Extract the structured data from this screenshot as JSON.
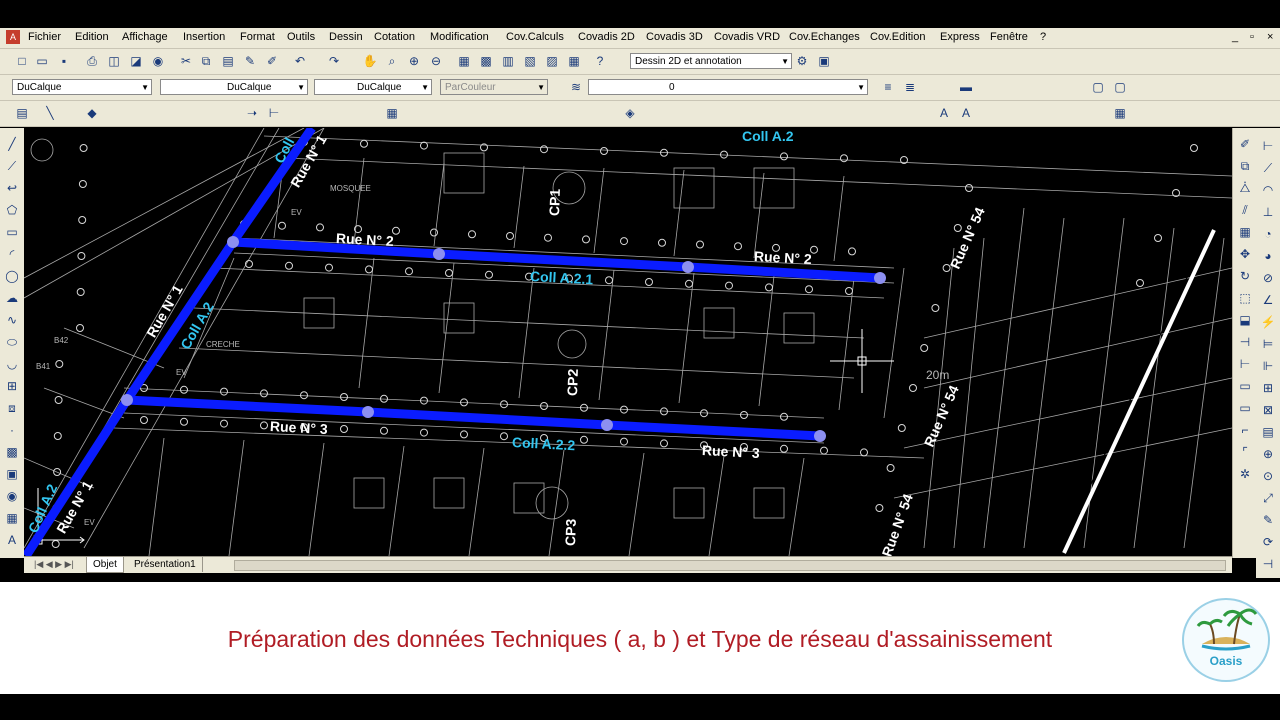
{
  "menu": [
    "Fichier",
    "Edition",
    "Affichage",
    "Insertion",
    "Format",
    "Outils",
    "Dessin",
    "Cotation",
    "Modification",
    "Cov.Calculs",
    "Covadis 2D",
    "Covadis 3D",
    "Covadis VRD",
    "Cov.Echanges",
    "Cov.Edition",
    "Express",
    "Fenêtre",
    "?"
  ],
  "window_controls": [
    "_",
    "▫",
    "×"
  ],
  "toolbar": {
    "workspace": "Dessin 2D et annotation",
    "color": "DuCalque",
    "linetype": "DuCalque",
    "lineweight": "DuCalque",
    "plotstyle": "ParCouleur",
    "layer": "0"
  },
  "icons": {
    "menu_app": "autocad-app-icon",
    "toolbar": [
      "new-icon",
      "open-icon",
      "save-icon",
      "print-icon",
      "preview-icon",
      "publish-icon",
      "plot-icon",
      "cut-icon",
      "copy-icon",
      "paste-icon",
      "matchprop-icon",
      "brush-icon",
      "undo-icon",
      "redo-icon",
      "pan-icon",
      "zoom-icon",
      "zoom-window-icon",
      "zoom-previous-icon",
      "properties-icon",
      "design-center-icon",
      "tool-palette-icon",
      "sheet-set-icon",
      "markup-icon",
      "calculator-icon",
      "help-icon"
    ]
  },
  "drawing": {
    "labels": {
      "coll_a2_top": "Coll A.2",
      "coll_a2_left": "Coll A.2",
      "coll_a2_bottom": "Coll A.2",
      "coll_a21": "Coll A.2.1",
      "coll_a22": "Coll A.2.2",
      "coll_top_left": "Coll",
      "rue1_top": "Rue N° 1",
      "rue1_mid": "Rue N° 1",
      "rue1_bottom": "Rue N° 1",
      "rue2_left": "Rue N° 2",
      "rue2_right": "Rue N° 2",
      "rue3_left": "Rue N° 3",
      "rue3_right": "Rue N° 3",
      "rue54_top": "Rue N° 54",
      "rue54_mid": "Rue N° 54",
      "rue54_bottom": "Rue N° 54",
      "cp1": "CP1",
      "cp2": "CP2",
      "cp3": "CP3",
      "mosquee": "MOSQUEE",
      "creche": "CRECHE",
      "ev1": "EV",
      "ev2": "EV",
      "ev3": "EV",
      "b42": "B42",
      "b41": "B41",
      "dim_20m": "20m"
    },
    "colors": {
      "collector": "#0a1cff",
      "node": "#8c8ff0",
      "street_text": "#ffffff",
      "coll_text": "#33c6f0",
      "background": "#000000",
      "parcel_lines": "#a8a8a8"
    }
  },
  "tabs": [
    "Objet",
    "Présentation1"
  ],
  "caption": "Préparation des données Techniques ( a, b ) et Type de réseau d'assainissement",
  "logo": {
    "text": "Oasis",
    "colors": {
      "ring": "#9ad0e6",
      "text": "#2a9fc8"
    }
  }
}
